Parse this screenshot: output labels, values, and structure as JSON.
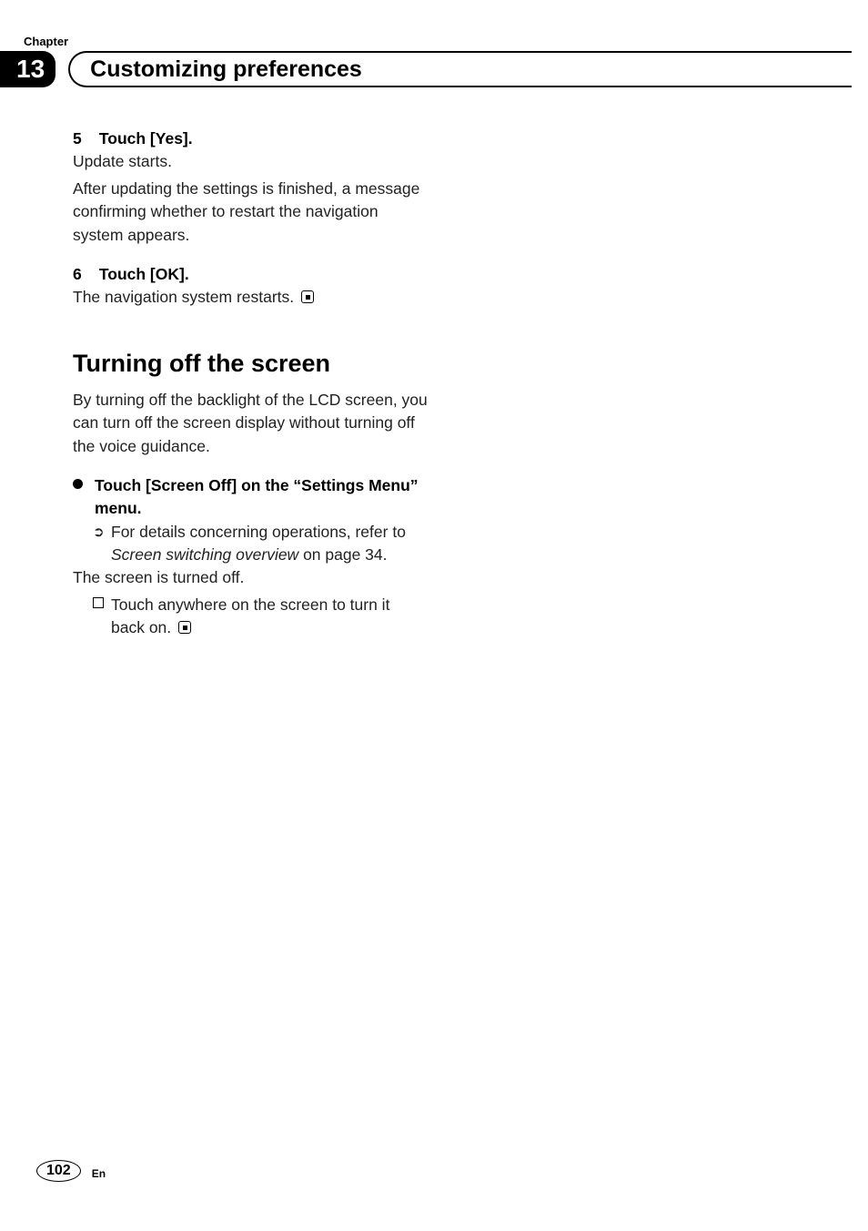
{
  "header": {
    "chapter_label": "Chapter",
    "chapter_number": "13",
    "section_title": "Customizing preferences"
  },
  "step5": {
    "num": "5",
    "heading": "Touch [Yes].",
    "line1": "Update starts.",
    "line2": "After updating the settings is finished, a mes­sage confirming whether to restart the naviga­tion system appears."
  },
  "step6": {
    "num": "6",
    "heading": "Touch [OK].",
    "line1": "The navigation system restarts."
  },
  "section2": {
    "heading": "Turning off the screen",
    "intro": "By turning off the backlight of the LCD screen, you can turn off the screen display without turning off the voice guidance.",
    "bullet_heading": "Touch [Screen Off] on the “Settings Menu” menu.",
    "ref_a": "For details concerning operations, refer to ",
    "ref_italic": "Screen switching overview",
    "ref_b": " on page 34.",
    "result": "The screen is turned off.",
    "note": "Touch anywhere on the screen to turn it back on."
  },
  "footer": {
    "page": "102",
    "lang": "En"
  }
}
